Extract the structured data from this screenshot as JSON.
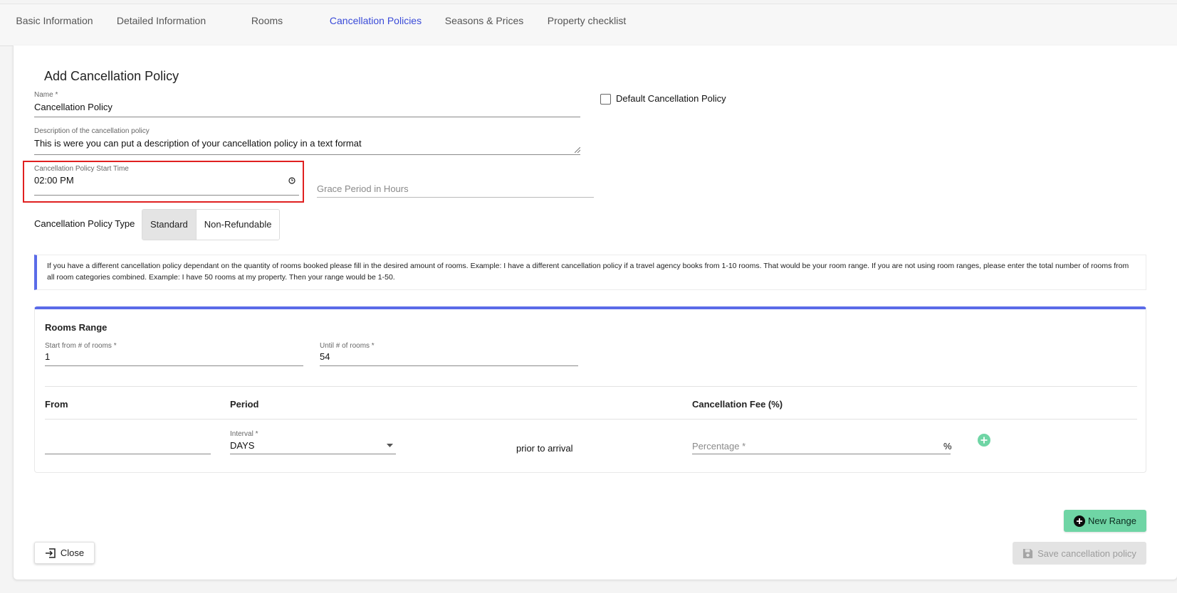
{
  "tabs": [
    {
      "label": "Basic Information"
    },
    {
      "label": "Detailed Information"
    },
    {
      "label": "Rooms"
    },
    {
      "label": "Cancellation Policies",
      "active": true
    },
    {
      "label": "Seasons & Prices"
    },
    {
      "label": "Property checklist"
    }
  ],
  "form": {
    "title": "Add Cancellation Policy",
    "name": {
      "label": "Name *",
      "value": "Cancellation Policy"
    },
    "default_policy": {
      "label": "Default Cancellation Policy",
      "checked": false
    },
    "description": {
      "label": "Description of the cancellation policy",
      "value": "This is were you can put a description of your cancellation policy in a text format"
    },
    "start_time": {
      "label": "Cancellation Policy Start Time",
      "value": "02:00 PM"
    },
    "grace_period": {
      "placeholder": "Grace Period in Hours"
    },
    "policy_type": {
      "label": "Cancellation Policy Type",
      "options": [
        "Standard",
        "Non-Refundable"
      ],
      "selected": "Standard"
    },
    "info_text": "If you have a different cancellation policy dependant on the quantity of rooms booked please fill in the desired amount of rooms. Example: I have a different cancellation policy if a travel agency books from 1-10 rooms. That would be your room range. If you are not using room ranges, please enter the total number of rooms from all room categories combined. Example: I have 50 rooms at my property. Then your range would be 1-50."
  },
  "rooms_range": {
    "title": "Rooms Range",
    "start": {
      "label": "Start from # of rooms *",
      "value": "1"
    },
    "until": {
      "label": "Until # of rooms *",
      "value": "54"
    },
    "columns": {
      "from": "From",
      "period": "Period",
      "fee": "Cancellation Fee (%)"
    },
    "row": {
      "from_value": "",
      "interval_label": "Interval *",
      "interval_value": "DAYS",
      "prior_text": "prior to arrival",
      "percentage_placeholder": "Percentage *",
      "percent_sign": "%"
    }
  },
  "buttons": {
    "new_range": "New Range",
    "close": "Close",
    "save": "Save cancellation policy"
  },
  "colors": {
    "accent": "#5a6be8",
    "green": "#6fd5a5",
    "highlight": "#e02020"
  }
}
